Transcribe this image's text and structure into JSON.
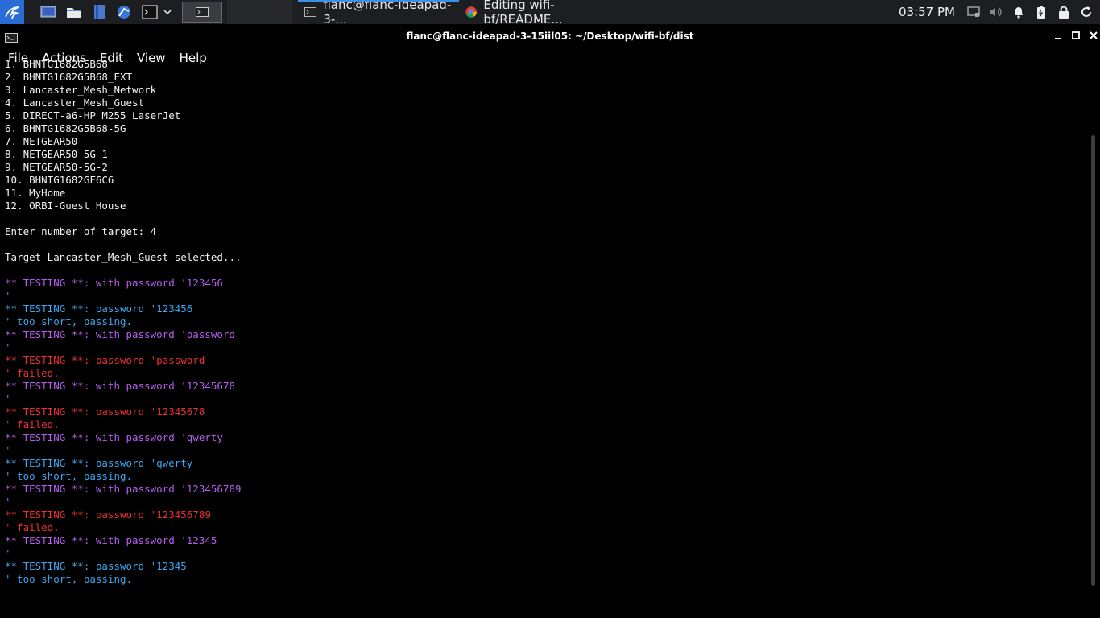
{
  "panel": {
    "tasks": [
      {
        "label": "flanc@flanc-ideapad-3-..."
      },
      {
        "label": "Editing wifi-bf/README..."
      }
    ],
    "clock": "03:57 PM"
  },
  "window": {
    "title": "flanc@flanc-ideapad-3-15iil05: ~/Desktop/wifi-bf/dist",
    "menu": [
      "File",
      "Actions",
      "Edit",
      "View",
      "Help"
    ]
  },
  "terminal": {
    "lines": [
      {
        "t": "1. BHNTG1682G5B68",
        "c": "white"
      },
      {
        "t": "2. BHNTG1682G5B68_EXT",
        "c": "white"
      },
      {
        "t": "3. Lancaster_Mesh_Network",
        "c": "white"
      },
      {
        "t": "4. Lancaster_Mesh_Guest",
        "c": "white"
      },
      {
        "t": "5. DIRECT-a6-HP M255 LaserJet",
        "c": "white"
      },
      {
        "t": "6. BHNTG1682G5B68-5G",
        "c": "white"
      },
      {
        "t": "7. NETGEAR50",
        "c": "white"
      },
      {
        "t": "8. NETGEAR50-5G-1",
        "c": "white"
      },
      {
        "t": "9. NETGEAR50-5G-2",
        "c": "white"
      },
      {
        "t": "10. BHNTG1682GF6C6",
        "c": "white"
      },
      {
        "t": "11. MyHome",
        "c": "white"
      },
      {
        "t": "12. ORBI-Guest House",
        "c": "white"
      },
      {
        "t": "",
        "c": "white"
      },
      {
        "t": "Enter number of target: 4",
        "c": "white"
      },
      {
        "t": "",
        "c": "white"
      },
      {
        "t": "Target Lancaster_Mesh_Guest selected...",
        "c": "white"
      },
      {
        "t": "",
        "c": "white"
      },
      {
        "t": "** TESTING **: with password '123456",
        "c": "purple"
      },
      {
        "t": "'",
        "c": "purple"
      },
      {
        "t": "** TESTING **: password '123456",
        "c": "blue"
      },
      {
        "t": "' too short, passing.",
        "c": "blue"
      },
      {
        "t": "** TESTING **: with password 'password",
        "c": "purple"
      },
      {
        "t": "'",
        "c": "purple"
      },
      {
        "t": "** TESTING **: password 'password",
        "c": "red"
      },
      {
        "t": "' failed.",
        "c": "red"
      },
      {
        "t": "** TESTING **: with password '12345678",
        "c": "purple"
      },
      {
        "t": "'",
        "c": "purple"
      },
      {
        "t": "** TESTING **: password '12345678",
        "c": "red"
      },
      {
        "t": "' failed.",
        "c": "red"
      },
      {
        "t": "** TESTING **: with password 'qwerty",
        "c": "purple"
      },
      {
        "t": "'",
        "c": "purple"
      },
      {
        "t": "** TESTING **: password 'qwerty",
        "c": "blue"
      },
      {
        "t": "' too short, passing.",
        "c": "blue"
      },
      {
        "t": "** TESTING **: with password '123456789",
        "c": "purple"
      },
      {
        "t": "'",
        "c": "purple"
      },
      {
        "t": "** TESTING **: password '123456789",
        "c": "red"
      },
      {
        "t": "' failed.",
        "c": "red"
      },
      {
        "t": "** TESTING **: with password '12345",
        "c": "purple"
      },
      {
        "t": "'",
        "c": "purple"
      },
      {
        "t": "** TESTING **: password '12345",
        "c": "blue"
      },
      {
        "t": "' too short, passing.",
        "c": "blue"
      }
    ]
  },
  "colors": {
    "purple": "#b65df0",
    "blue": "#3aa7f0",
    "red": "#ec3030",
    "panel": "#1d1e22",
    "accent": "#3c8fe8"
  }
}
